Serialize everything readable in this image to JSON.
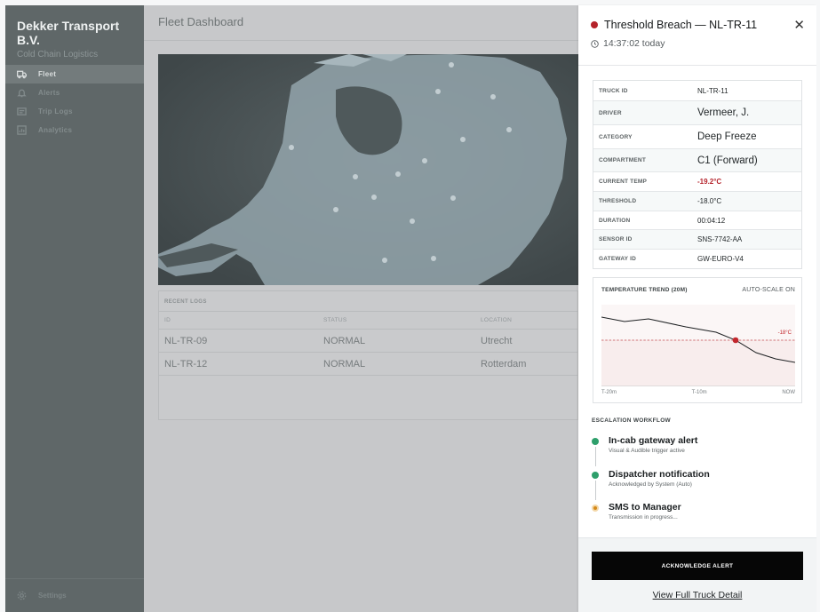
{
  "sidebar": {
    "brand_name": "Dekker Transport B.V.",
    "brand_sub": "Cold Chain Logistics",
    "items": [
      {
        "label": "Fleet",
        "icon": "truck-icon",
        "active": true
      },
      {
        "label": "Alerts",
        "icon": "bell-icon",
        "active": false
      },
      {
        "label": "Trip Logs",
        "icon": "trip-logs-icon",
        "active": false
      },
      {
        "label": "Analytics",
        "icon": "analytics-icon",
        "active": false
      }
    ],
    "settings_label": "Settings"
  },
  "main": {
    "title": "Fleet Dashboard",
    "logs": {
      "title": "RECENT LOGS",
      "columns": [
        "ID",
        "STATUS",
        "LOCATION"
      ],
      "rows": [
        {
          "id": "NL-TR-09",
          "status": "NORMAL",
          "location": "Utrecht"
        },
        {
          "id": "NL-TR-12",
          "status": "NORMAL",
          "location": "Rotterdam"
        }
      ]
    }
  },
  "panel": {
    "title": "Threshold Breach — NL-TR-11",
    "time": "14:37:02 today",
    "details": [
      {
        "label": "TRUCK ID",
        "value": "NL-TR-11",
        "style": "normal"
      },
      {
        "label": "DRIVER",
        "value": "Vermeer, J.",
        "style": "big"
      },
      {
        "label": "CATEGORY",
        "value": "Deep Freeze",
        "style": "big"
      },
      {
        "label": "COMPARTMENT",
        "value": "C1 (Forward)",
        "style": "big"
      },
      {
        "label": "CURRENT TEMP",
        "value": "-19.2°C",
        "style": "red"
      },
      {
        "label": "THRESHOLD",
        "value": "-18.0°C",
        "style": "normal"
      },
      {
        "label": "DURATION",
        "value": "00:04:12",
        "style": "normal"
      },
      {
        "label": "SENSOR ID",
        "value": "SNS-7742-AA",
        "style": "normal"
      },
      {
        "label": "GATEWAY ID",
        "value": "GW-EURO-V4",
        "style": "normal"
      }
    ],
    "trend": {
      "title": "TEMPERATURE TREND (20M)",
      "autoscale": "AUTO-SCALE ON",
      "threshold_label": "-18°C",
      "x_labels": [
        "T-20m",
        "T-10m",
        "NOW"
      ]
    },
    "escalation": {
      "title": "ESCALATION WORKFLOW",
      "steps": [
        {
          "name": "In-cab gateway alert",
          "sub": "Visual & Audible trigger active",
          "state": "done"
        },
        {
          "name": "Dispatcher notification",
          "sub": "Acknowledged by System (Auto)",
          "state": "done"
        },
        {
          "name": "SMS to Manager",
          "sub": "Transmission in progress...",
          "state": "pending"
        }
      ]
    },
    "ack_label": "ACKNOWLEDGE ALERT",
    "view_label": "View Full Truck Detail"
  },
  "colors": {
    "alert_red": "#b4222a",
    "done_green": "#2e9f6b",
    "pending_orange": "#d58a1a"
  }
}
